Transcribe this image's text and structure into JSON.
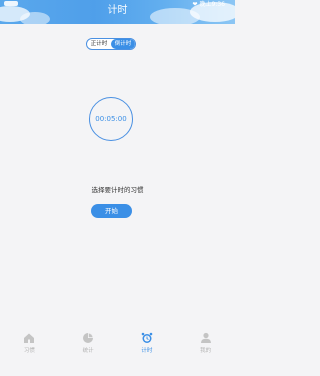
{
  "header": {
    "title": "计时",
    "status_text": "晚上9:36"
  },
  "mode_toggle": {
    "options": [
      "正计时",
      "倒计时"
    ],
    "active_index": 1
  },
  "timer": {
    "display": "00:05:00"
  },
  "prompt": "选择要计时的习惯",
  "start_button": "开始",
  "tabbar": {
    "items": [
      {
        "label": "习惯",
        "icon": "house-icon",
        "active": false
      },
      {
        "label": "统计",
        "icon": "pie-chart-icon",
        "active": false
      },
      {
        "label": "计时",
        "icon": "alarm-clock-icon",
        "active": true
      },
      {
        "label": "我的",
        "icon": "person-icon",
        "active": false
      }
    ]
  },
  "colors": {
    "accent": "#3b8fe6",
    "inactive": "#b5b5b5",
    "background": "#f4f4f6"
  }
}
